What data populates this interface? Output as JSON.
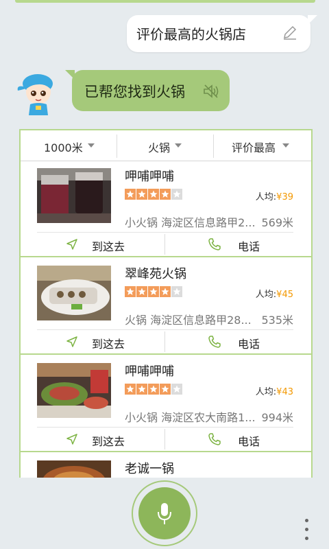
{
  "query": {
    "text": "评价最高的火锅店",
    "edit_icon": "pencil-icon"
  },
  "reply": {
    "text": "已帮您找到火锅",
    "speaker_icon": "speaker-muted-icon"
  },
  "filters": [
    {
      "label": "1000米"
    },
    {
      "label": "火锅"
    },
    {
      "label": "评价最高"
    }
  ],
  "results": [
    {
      "name": "呷哺呷哺",
      "rating": 4,
      "avg_label": "人均:",
      "price": "¥39",
      "address": "小火锅 海淀区信息路甲2...",
      "distance": "569米",
      "go_label": "到这去",
      "call_label": "电话"
    },
    {
      "name": "翠峰苑火锅",
      "rating": 4,
      "avg_label": "人均:",
      "price": "¥45",
      "address": "火锅 海淀区信息路甲28...",
      "distance": "535米",
      "go_label": "到这去",
      "call_label": "电话"
    },
    {
      "name": "呷哺呷哺",
      "rating": 4,
      "avg_label": "人均:",
      "price": "¥43",
      "address": "小火锅 海淀区农大南路1...",
      "distance": "994米",
      "go_label": "到这去",
      "call_label": "电话"
    },
    {
      "name": "老诚一锅"
    }
  ],
  "colors": {
    "accent": "#a5c97a",
    "price": "#f39800",
    "star": "#f39c5a",
    "background": "#e6ebee"
  }
}
